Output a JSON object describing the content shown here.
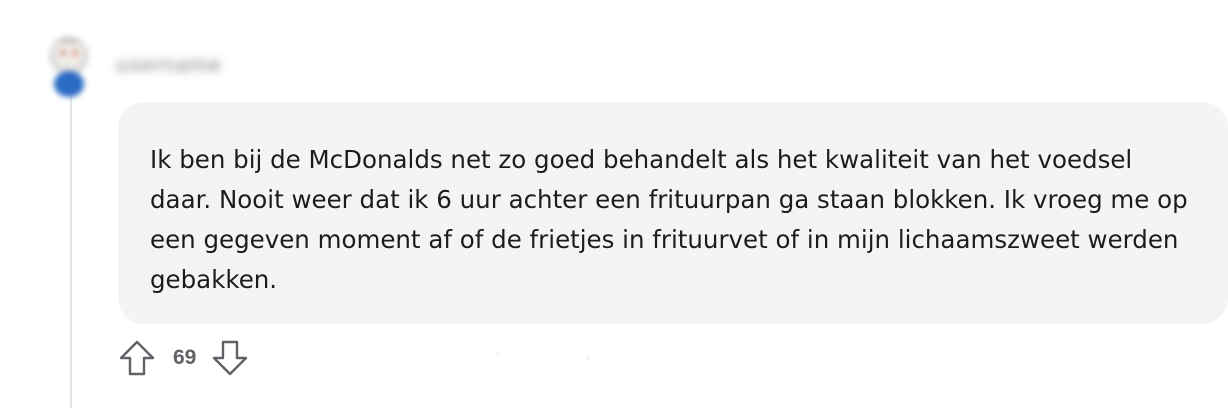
{
  "comment": {
    "username": "username",
    "body": "Ik ben bij de McDonalds net zo goed behandelt als het kwaliteit van het voedsel daar. Nooit weer dat ik 6 uur achter een frituurpan ga staan blokken. Ik vroeg me op een gegeven moment af of de frietjes in frituurvet of in mijn lichaamszweet werden gebakken.",
    "score": "69"
  },
  "icons": {
    "avatar": "snoo-avatar-icon",
    "upvote": "upvote-arrow-icon",
    "downvote": "downvote-arrow-icon"
  },
  "colors": {
    "bubble_background": "#f3f4f4",
    "thread_line": "#e4e6e8",
    "text": "#1c1c1c",
    "vote_icon": "#5f6368"
  }
}
